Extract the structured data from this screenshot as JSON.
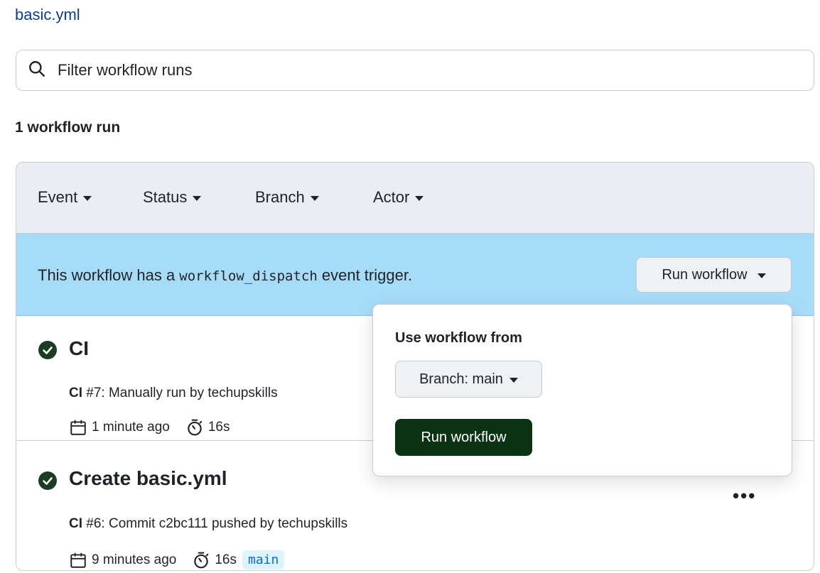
{
  "workflow_file": "basic.yml",
  "filter": {
    "placeholder": "Filter workflow runs"
  },
  "run_count": "1 workflow run",
  "filters": [
    {
      "label": "Event"
    },
    {
      "label": "Status"
    },
    {
      "label": "Branch"
    },
    {
      "label": "Actor"
    }
  ],
  "dispatch_banner": {
    "text_before": "This workflow has a ",
    "code": "workflow_dispatch",
    "text_after": " event trigger.",
    "button_label": "Run workflow"
  },
  "runs": [
    {
      "status": "success",
      "title": "CI",
      "workflow": "CI",
      "meta": " #7: Manually run by techupskills",
      "time": "1 minute ago",
      "duration": "16s",
      "branch": ""
    },
    {
      "status": "success",
      "title": "Create basic.yml",
      "workflow": "CI",
      "meta": " #6: Commit c2bc111 pushed by techupskills",
      "time": "9 minutes ago",
      "duration": "16s",
      "branch": "main"
    }
  ],
  "dropdown": {
    "title": "Use workflow from",
    "branch_label": "Branch: main",
    "submit_label": "Run workflow"
  },
  "colors": {
    "success": "#1a7f37",
    "banner": "#a7dcf9",
    "primary_button": "#0a3314",
    "link": "#0b3d91"
  },
  "icons": {
    "search": "search-icon",
    "check": "check-circle-icon",
    "calendar": "calendar-icon",
    "stopwatch": "stopwatch-icon",
    "kebab": "kebab-horizontal-icon"
  }
}
